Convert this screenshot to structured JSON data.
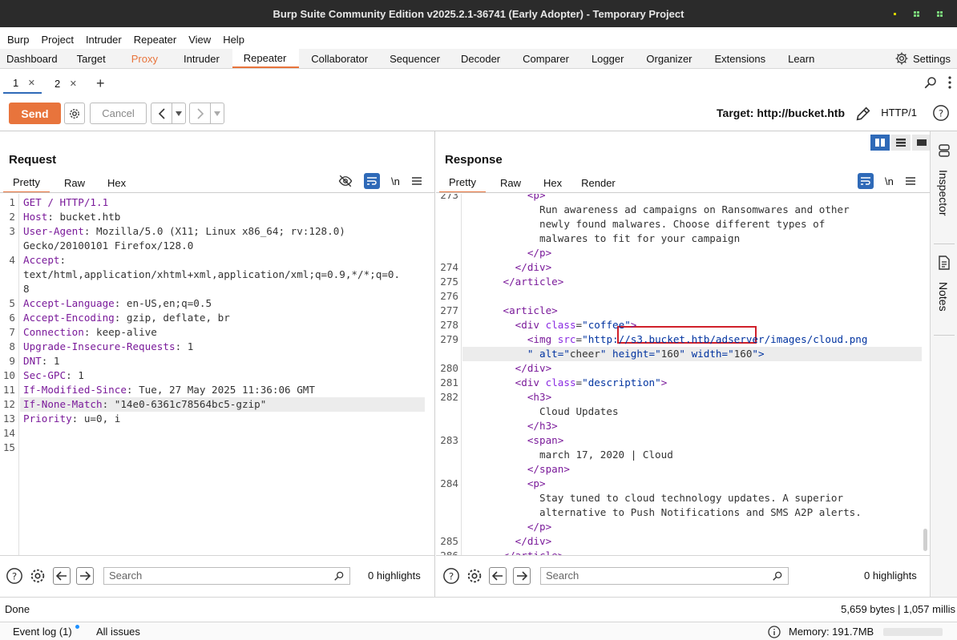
{
  "window": {
    "title": "Burp Suite Community Edition v2025.2.1-36741 (Early Adopter) - Temporary Project"
  },
  "menu": [
    "Burp",
    "Project",
    "Intruder",
    "Repeater",
    "View",
    "Help"
  ],
  "main_tabs": [
    "Dashboard",
    "Target",
    "Proxy",
    "Intruder",
    "Repeater",
    "Collaborator",
    "Sequencer",
    "Decoder",
    "Comparer",
    "Logger",
    "Organizer",
    "Extensions",
    "Learn"
  ],
  "settings_label": "Settings",
  "repeater_tabs": [
    {
      "label": "1"
    },
    {
      "label": "2"
    }
  ],
  "toolbar": {
    "send": "Send",
    "cancel": "Cancel",
    "target": "Target: http://bucket.htb",
    "http_version": "HTTP/1"
  },
  "request": {
    "title": "Request",
    "tabs": [
      "Pretty",
      "Raw",
      "Hex"
    ],
    "wrap_glyph": "\\n",
    "lines": [
      {
        "n": "1",
        "k": "GET / HTTP/1.1",
        "v": ""
      },
      {
        "n": "2",
        "k": "Host",
        "v": ": bucket.htb"
      },
      {
        "n": "3",
        "k": "User-Agent",
        "v": ": Mozilla/5.0 (X11; Linux x86_64; rv:128.0)"
      },
      {
        "n": "",
        "k": "",
        "v": "Gecko/20100101 Firefox/128.0"
      },
      {
        "n": "4",
        "k": "Accept",
        "v": ":"
      },
      {
        "n": "",
        "k": "",
        "v": "text/html,application/xhtml+xml,application/xml;q=0.9,*/*;q=0."
      },
      {
        "n": "",
        "k": "",
        "v": "8"
      },
      {
        "n": "5",
        "k": "Accept-Language",
        "v": ": en-US,en;q=0.5"
      },
      {
        "n": "6",
        "k": "Accept-Encoding",
        "v": ": gzip, deflate, br"
      },
      {
        "n": "7",
        "k": "Connection",
        "v": ": keep-alive"
      },
      {
        "n": "8",
        "k": "Upgrade-Insecure-Requests",
        "v": ": 1"
      },
      {
        "n": "9",
        "k": "DNT",
        "v": ": 1"
      },
      {
        "n": "10",
        "k": "Sec-GPC",
        "v": ": 1"
      },
      {
        "n": "11",
        "k": "If-Modified-Since",
        "v": ": Tue, 27 May 2025 11:36:06 GMT"
      },
      {
        "n": "12",
        "k": "If-None-Match",
        "v": ": \"14e0-6361c78564bc5-gzip\""
      },
      {
        "n": "13",
        "k": "Priority",
        "v": ": u=0, i"
      },
      {
        "n": "14",
        "k": "",
        "v": ""
      },
      {
        "n": "15",
        "k": "",
        "v": ""
      }
    ],
    "search_placeholder": "Search",
    "highlights": "0 highlights"
  },
  "response": {
    "title": "Response",
    "tabs": [
      "Pretty",
      "Raw",
      "Hex",
      "Render"
    ],
    "wrap_glyph": "\\n",
    "lines": [
      {
        "n": "273",
        "t": "          <p>"
      },
      {
        "n": "",
        "t": "            Run awareness ad campaigns on Ransomwares and other"
      },
      {
        "n": "",
        "t": "            newly found malwares. Choose different types of"
      },
      {
        "n": "",
        "t": "            malwares to fit for your campaign"
      },
      {
        "n": "",
        "t": "          </p>"
      },
      {
        "n": "274",
        "t": "        </div>"
      },
      {
        "n": "275",
        "t": "      </article>"
      },
      {
        "n": "276",
        "t": ""
      },
      {
        "n": "277",
        "t": "      <article>"
      },
      {
        "n": "278",
        "t": "        <div class=\"coffee\">"
      },
      {
        "n": "279",
        "t": "          <img src=\"http://s3.bucket.htb/adserver/images/cloud.png"
      },
      {
        "n": "",
        "t": "          \" alt=\"cheer\" height=\"160\" width=\"160\">"
      },
      {
        "n": "280",
        "t": "        </div>"
      },
      {
        "n": "281",
        "t": "        <div class=\"description\">"
      },
      {
        "n": "282",
        "t": "          <h3>"
      },
      {
        "n": "",
        "t": "            Cloud Updates"
      },
      {
        "n": "",
        "t": "          </h3>"
      },
      {
        "n": "283",
        "t": "          <span>"
      },
      {
        "n": "",
        "t": "            march 17, 2020 | Cloud"
      },
      {
        "n": "",
        "t": "          </span>"
      },
      {
        "n": "284",
        "t": "          <p>"
      },
      {
        "n": "",
        "t": "            Stay tuned to cloud technology updates. A superior"
      },
      {
        "n": "",
        "t": "            alternative to Push Notifications and SMS A2P alerts."
      },
      {
        "n": "",
        "t": "          </p>"
      },
      {
        "n": "285",
        "t": "        </div>"
      },
      {
        "n": "286",
        "t": "      </article>"
      }
    ],
    "search_placeholder": "Search",
    "highlights": "0 highlights"
  },
  "sidebar": {
    "inspector": "Inspector",
    "notes": "Notes"
  },
  "status": {
    "left": "Done",
    "right": "5,659 bytes | 1,057 millis"
  },
  "footer": {
    "event_log": "Event log (1)",
    "all_issues": "All issues",
    "memory": "Memory: 191.7MB"
  },
  "colors": {
    "accent": "#e8743c",
    "selected_blue": "#2f6ab8",
    "annotation_red": "#d0202a"
  }
}
